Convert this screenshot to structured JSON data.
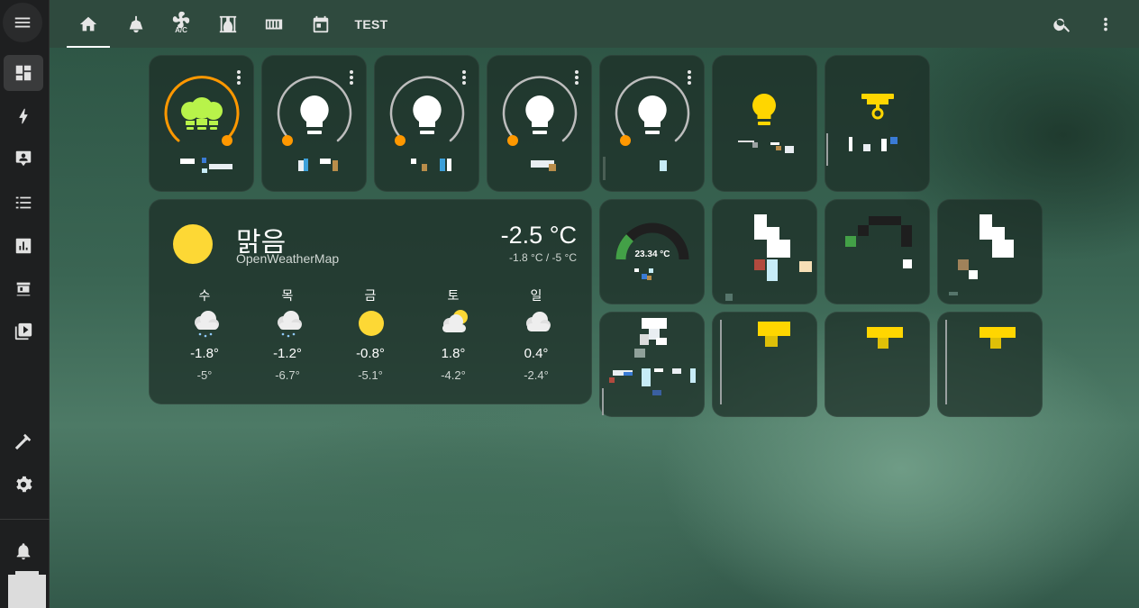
{
  "topbar": {
    "tabs": [
      {
        "icon": "home-icon"
      },
      {
        "icon": "ceiling-lamp-icon"
      },
      {
        "icon": "air-conditioner-icon",
        "sub_label": "A/C"
      },
      {
        "icon": "curtains-icon"
      },
      {
        "icon": "radiator-icon"
      },
      {
        "icon": "calendar-icon"
      },
      {
        "label": "TEST"
      }
    ],
    "actions": [
      "search-icon",
      "more-vert-icon"
    ]
  },
  "sidebar": {
    "items": [
      "menu-icon",
      "dashboard-icon",
      "energy-icon",
      "logbook-icon",
      "history-icon",
      "statistics-icon",
      "hacs-icon",
      "media-icon",
      "developer-tools-icon",
      "settings-icon",
      "notifications-icon",
      "avatar"
    ]
  },
  "colors": {
    "light_on": "#ff9800",
    "bulb_green": "#b8f34a",
    "bulb_yellow": "#ffd600",
    "gauge_green": "#43a047",
    "sun": "#fdd835"
  },
  "lights": [
    {
      "state": "on"
    },
    {
      "state": "off"
    },
    {
      "state": "off"
    },
    {
      "state": "off"
    },
    {
      "state": "off"
    }
  ],
  "weather": {
    "condition": "맑음",
    "source": "OpenWeatherMap",
    "temperature": "-2.5 °C",
    "range": "-1.8 °C / -5 °C",
    "forecast": [
      {
        "day": "수",
        "icon": "snowy-cloud-icon",
        "high": "-1.8°",
        "low": "-5°"
      },
      {
        "day": "목",
        "icon": "snowy-cloud-icon",
        "high": "-1.2°",
        "low": "-6.7°"
      },
      {
        "day": "금",
        "icon": "sunny-icon",
        "high": "-0.8°",
        "low": "-5.1°"
      },
      {
        "day": "토",
        "icon": "partly-cloudy-icon",
        "high": "1.8°",
        "low": "-4.2°"
      },
      {
        "day": "일",
        "icon": "cloudy-icon",
        "high": "0.4°",
        "low": "-2.4°"
      }
    ]
  },
  "gauge": {
    "value": "23.34 °C"
  }
}
